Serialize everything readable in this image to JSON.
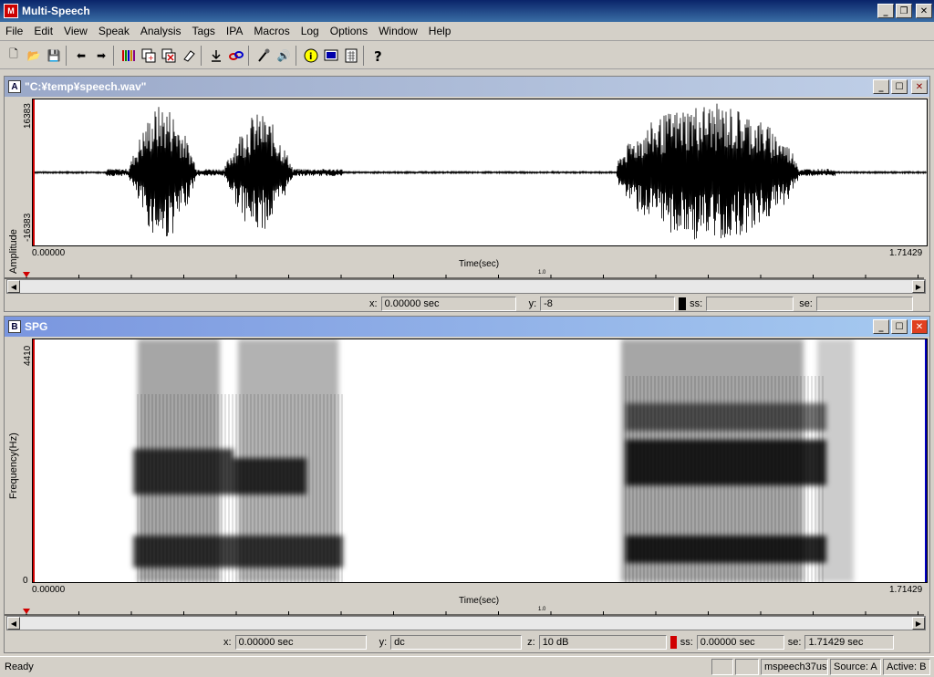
{
  "app": {
    "title": "Multi-Speech"
  },
  "menu": [
    "File",
    "Edit",
    "View",
    "Speak",
    "Analysis",
    "Tags",
    "IPA",
    "Macros",
    "Log",
    "Options",
    "Window",
    "Help"
  ],
  "toolbar_icons": [
    "new-file-icon",
    "open-folder-icon",
    "save-icon",
    "back-arrow-icon",
    "forward-arrow-icon",
    "color-bars-icon",
    "copy-window-icon",
    "close-window-icon",
    "eraser-icon",
    "download-icon",
    "link-icon",
    "microphone-icon",
    "speaker-icon",
    "info-icon",
    "monitor-icon",
    "calculator-icon",
    "help-icon"
  ],
  "paneA": {
    "letter": "A",
    "name": "\"C:¥temp¥speech.wav\"",
    "ylabel": "Amplitude",
    "ymax": "16383",
    "ymin": "-16383",
    "xmin": "0.00000",
    "xmax": "1.71429",
    "xlabel": "Time(sec)",
    "mid": "1.0",
    "x_label": "x:",
    "x_value": "0.00000 sec",
    "y_label": "y:",
    "y_value": "-8",
    "ss_label": "ss:",
    "ss_value": "",
    "se_label": "se:",
    "se_value": ""
  },
  "paneB": {
    "letter": "B",
    "name": "SPG",
    "ylabel": "Frequency(Hz)",
    "ymax": "4410",
    "ymin": "0",
    "xmin": "0.00000",
    "xmax": "1.71429",
    "xlabel": "Time(sec)",
    "mid": "1.0",
    "x_label": "x:",
    "x_value": "0.00000 sec",
    "y_label": "y:",
    "y_value": "dc",
    "z_label": "z:",
    "z_value": "10 dB",
    "ss_label": "ss:",
    "ss_value": "0.00000 sec",
    "se_label": "se:",
    "se_value": "1.71429 sec"
  },
  "status": {
    "ready": "Ready",
    "file": "mspeech37use",
    "source": "Source: A",
    "active": "Active: B"
  },
  "colors": {
    "title_bar": "#0a246a",
    "pane_title": "#7a96df",
    "close_red": "#e04020",
    "marker_red": "#d00000"
  }
}
